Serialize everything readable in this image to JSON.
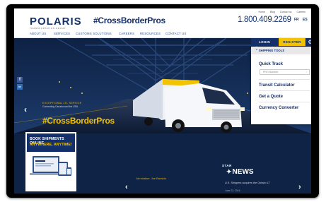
{
  "header": {
    "logo_text": "POLARIS",
    "logo_subtitle": "TRANSPORTATION GROUP",
    "tagline": "#CrossBorderPros",
    "phone": "1.800.409.2269",
    "top_links": [
      "Home",
      "Blog",
      "Contact us",
      "Careers"
    ],
    "lang_fr": "FR",
    "lang_es": "ES"
  },
  "nav": {
    "items": [
      "ABOUT US",
      "SERVICES",
      "CUSTOMS SOLUTIONS",
      "CAREERS",
      "RESOURCES",
      "CONTACT US"
    ]
  },
  "account": {
    "login_label": "LOGIN",
    "register_label": "REGISTER"
  },
  "shipping_tools": {
    "header": "SHIPPING TOOLS",
    "quick_track": "Quick Track",
    "pro_placeholder": "PRO Number",
    "items": [
      "Transit Calculator",
      "Get a Quote",
      "Currency Converter"
    ]
  },
  "hero": {
    "series_label": "EXCEPTIONAL LTL SERVICE",
    "series_sub": "Connecting Canada and the USA",
    "hashtag": "#CrossBorderPros"
  },
  "social": {
    "facebook": "f",
    "linkedin": "in"
  },
  "promo": {
    "line1": "BOOK SHIPMENTS ONLINE",
    "line2": "ANYWHERE, ANYTIME!"
  },
  "news": {
    "left_title": "Job station: Joe Baraldo",
    "star_label": "STAR",
    "news_label": "NEWS",
    "headline": "U.S. Shippers acquires the Ontario LT",
    "date": "June 22, 2016"
  },
  "colors": {
    "brand_navy": "#13306b",
    "brand_yellow": "#f4c300"
  }
}
